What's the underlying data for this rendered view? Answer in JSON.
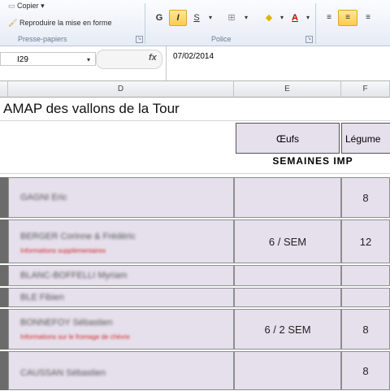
{
  "ribbon": {
    "clipboard": {
      "copy_label": "Copier",
      "format_painter_label": "Reproduire la mise en forme",
      "group_label": "Presse-papiers"
    },
    "font": {
      "group_label": "Police",
      "bold": "G",
      "italic": "I",
      "underline": "S"
    }
  },
  "formula_bar": {
    "cell_ref": "I29",
    "fx": "fx",
    "value": "07/02/2014"
  },
  "columns": [
    "D",
    "E",
    "F"
  ],
  "sheet": {
    "title": "AMAP des vallons de la Tour",
    "header_eggs": "Œufs",
    "header_vegetables": "Légume",
    "section_label": "SEMAINES IMP",
    "rows": [
      {
        "name": "GAGNI Eric",
        "note": "",
        "eggs": "",
        "veg": "8"
      },
      {
        "name": "BERGER Corinne & Frédéric",
        "note": "Informations supplémentaires",
        "eggs": "6 / SEM",
        "veg": "12"
      },
      {
        "name": "BLANC-BOFFELLI Myriam",
        "note": "",
        "eggs": "",
        "veg": ""
      },
      {
        "name": "BLE Fibien",
        "note": "",
        "eggs": "",
        "veg": ""
      },
      {
        "name": "BONNEFOY Sébastien",
        "note": "Informations sur le fromage de chèvre",
        "eggs": "6 / 2 SEM",
        "veg": "8"
      },
      {
        "name": "CAUSSAN Sébastien",
        "note": "",
        "eggs": "",
        "veg": "8"
      }
    ]
  }
}
